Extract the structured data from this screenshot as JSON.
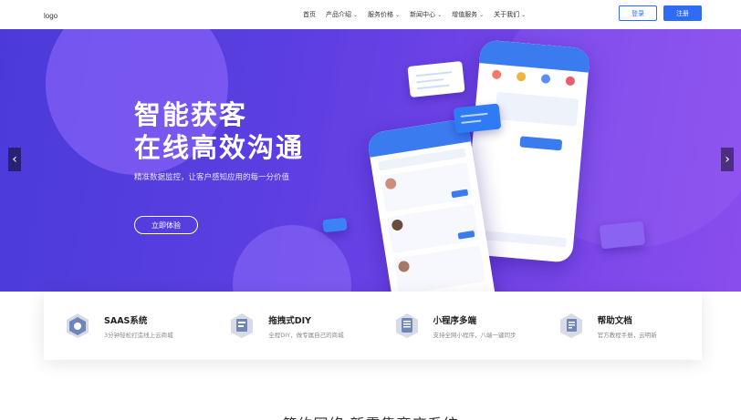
{
  "header": {
    "logo": "logo",
    "nav": [
      {
        "label": "首页",
        "has_dropdown": false
      },
      {
        "label": "产品介绍",
        "has_dropdown": true
      },
      {
        "label": "服务价格",
        "has_dropdown": true
      },
      {
        "label": "新闻中心",
        "has_dropdown": true
      },
      {
        "label": "增值服务",
        "has_dropdown": true
      },
      {
        "label": "关于我们",
        "has_dropdown": true
      }
    ],
    "login_label": "登录",
    "register_label": "注册"
  },
  "banner": {
    "headline_line1": "智能获客",
    "headline_line2": "在线高效沟通",
    "subline": "精准数据监控，让客户感知应用的每一分价值",
    "cta_label": "立即体验",
    "prev_arrow": "‹",
    "next_arrow": "›"
  },
  "features": [
    {
      "title": "SAAS系统",
      "desc": "3分钟轻松打造线上云商城",
      "icon": "saas-icon"
    },
    {
      "title": "拖拽式DIY",
      "desc": "全程DIY，做专属自己的商城",
      "icon": "diy-icon"
    },
    {
      "title": "小程序多端",
      "desc": "支持全网小程序，八端一键同步",
      "icon": "miniprogram-icon"
    },
    {
      "title": "帮助文档",
      "desc": "官方教程手册，云明新",
      "icon": "help-doc-icon"
    }
  ],
  "section_title": "简约网络  新零售商店系统",
  "colors": {
    "primary": "#2f6bf5",
    "banner_start": "#4a3bd9",
    "banner_end": "#8a4ded"
  }
}
